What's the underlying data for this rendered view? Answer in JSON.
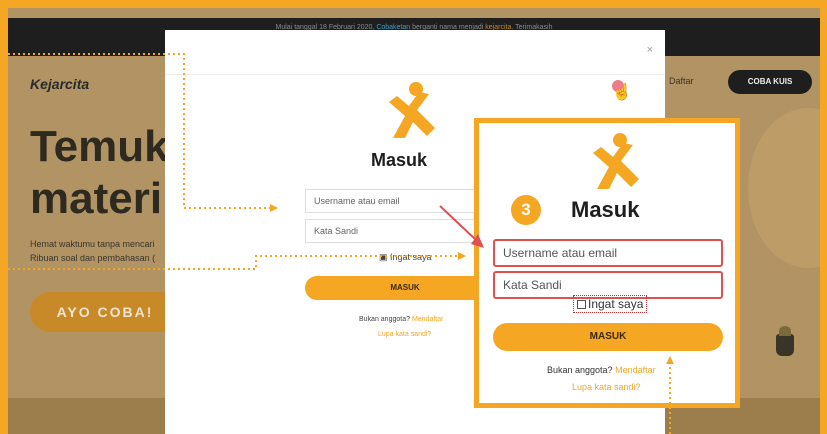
{
  "banner": {
    "text_before": "Mulai tanggal 18 Februari 2020, ",
    "old_name": "Cobaketan",
    "text_mid": " berganti nama menjadi ",
    "new_name": "kejarcita",
    "text_after": ". Terimakasih"
  },
  "header": {
    "logo": "Kejarcita",
    "register_label": "Daftar",
    "quiz_button": "COBA KUIS"
  },
  "hero": {
    "line1": "Temukan",
    "line2": "materi",
    "sub1": "Hemat waktumu tanpa mencari",
    "sub2": "Ribuan soal dan pembahasan (",
    "cta": "AYO COBA!"
  },
  "modal": {
    "close": "×",
    "title": "Masuk",
    "username_placeholder": "Username atau email",
    "password_placeholder": "Kata Sandi",
    "remember_label": "Ingat saya",
    "submit_label": "MASUK",
    "not_member": "Bukan anggota?",
    "register_link": "Mendaftar",
    "forgot_link": "Lupa kata sandi?"
  },
  "zoom": {
    "step_number": "3",
    "title": "Masuk",
    "username_placeholder": "Username atau email",
    "password_placeholder": "Kata Sandi",
    "remember_label": "Ingat saya",
    "submit_label": "MASUK",
    "not_member": "Bukan anggota?",
    "register_link": "Mendaftar",
    "forgot_link": "Lupa kata sandi?"
  },
  "colors": {
    "accent": "#f5a623",
    "highlight_border": "#e05050",
    "dim_overlay": "#b29464",
    "banner_bg": "#1e1e1e"
  },
  "icons": [
    "kejarcita-logo-icon",
    "close-icon",
    "hand-cursor-icon",
    "checkbox-icon",
    "arrow-icon"
  ]
}
